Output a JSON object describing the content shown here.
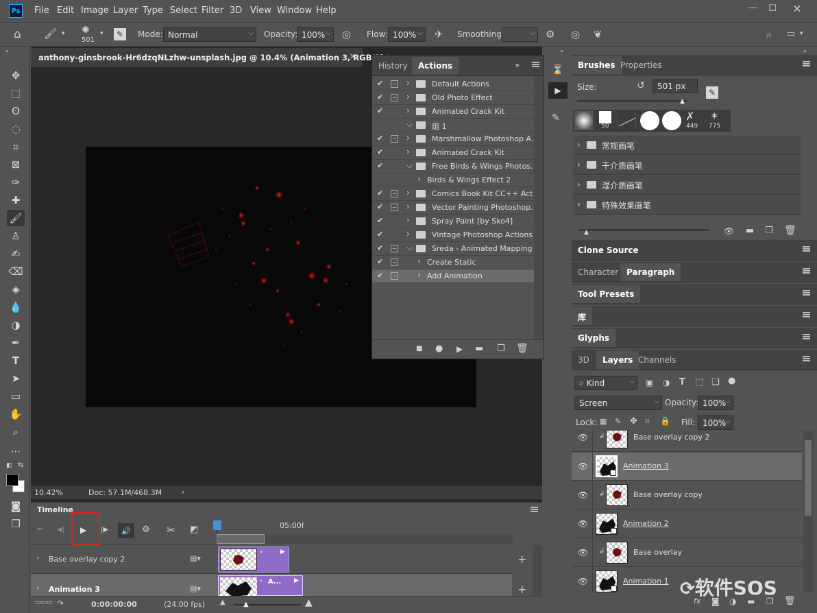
{
  "menu": {
    "logo": "Ps",
    "items": [
      "File",
      "Edit",
      "Image",
      "Layer",
      "Type",
      "Select",
      "Filter",
      "3D",
      "View",
      "Window",
      "Help"
    ]
  },
  "options": {
    "brush_size": "501",
    "mode_label": "Mode:",
    "mode_value": "Normal",
    "opacity_label": "Opacity:",
    "opacity_value": "100%",
    "flow_label": "Flow:",
    "flow_value": "100%",
    "smoothing_label": "Smoothing:",
    "smoothing_value": ""
  },
  "document": {
    "tab_title": "anthony-ginsbrook-Hr6dzqNLzhw-unsplash.jpg @ 10.4% (Animation 3, RGB/8) *",
    "zoom": "10.42%",
    "doc_info": "Doc: 57.1M/468.3M"
  },
  "actions_panel": {
    "tabs": [
      "History",
      "Actions"
    ],
    "rows": [
      {
        "check": "✔",
        "dialog": true,
        "indent": 0,
        "expanded": false,
        "folder": true,
        "label": "Default Actions"
      },
      {
        "check": "✔",
        "dialog": true,
        "indent": 0,
        "expanded": false,
        "folder": true,
        "label": "Old Photo Effect"
      },
      {
        "check": "✔",
        "dialog": false,
        "indent": 0,
        "expanded": false,
        "folder": true,
        "label": "Animated Crack Kit"
      },
      {
        "check": "",
        "dialog": false,
        "indent": 0,
        "expanded": true,
        "folder": true,
        "label": "组 1"
      },
      {
        "check": "✔",
        "dialog": true,
        "indent": 0,
        "expanded": false,
        "folder": true,
        "label": "Marshmallow Photoshop A..."
      },
      {
        "check": "✔",
        "dialog": false,
        "indent": 0,
        "expanded": false,
        "folder": true,
        "label": "Animated Crack Kit"
      },
      {
        "check": "✔",
        "dialog": false,
        "indent": 0,
        "expanded": true,
        "folder": true,
        "label": "Free Birds & Wings Photos..."
      },
      {
        "check": "",
        "dialog": false,
        "indent": 1,
        "expanded": false,
        "folder": false,
        "label": "Birds & Wings Effect 2"
      },
      {
        "check": "✔",
        "dialog": true,
        "indent": 0,
        "expanded": false,
        "folder": true,
        "label": "Comics Book Kit CC++ Act..."
      },
      {
        "check": "✔",
        "dialog": true,
        "indent": 0,
        "expanded": false,
        "folder": true,
        "label": "Vector Painting Photoshop..."
      },
      {
        "check": "✔",
        "dialog": false,
        "indent": 0,
        "expanded": false,
        "folder": true,
        "label": "Spray Paint [by Sko4]"
      },
      {
        "check": "✔",
        "dialog": false,
        "indent": 0,
        "expanded": false,
        "folder": true,
        "label": "Vintage Photoshop Actions"
      },
      {
        "check": "✔",
        "dialog": true,
        "indent": 0,
        "expanded": true,
        "folder": true,
        "label": "Sreda - Animated Mapping"
      },
      {
        "check": "✔",
        "dialog": true,
        "indent": 1,
        "expanded": false,
        "folder": false,
        "label": "Create Static"
      },
      {
        "check": "✔",
        "dialog": true,
        "indent": 1,
        "expanded": false,
        "folder": false,
        "label": "Add Animation",
        "selected": true
      }
    ]
  },
  "brushes_panel": {
    "tabs": [
      "Brushes",
      "Properties"
    ],
    "size_label": "Size:",
    "size_value": "501 px",
    "presets": [
      "50",
      "",
      "",
      "",
      "",
      "449",
      "775"
    ],
    "groups": [
      "常规画笔",
      "干介质画笔",
      "湿介质画笔",
      "特殊效果画笔"
    ]
  },
  "collapsed_panels": {
    "clone_source": "Clone Source",
    "character": "Character",
    "paragraph": "Paragraph",
    "tool_presets": "Tool Presets",
    "library": "库",
    "glyphs": "Glyphs"
  },
  "layers_panel": {
    "tabs": [
      "3D",
      "Layers",
      "Channels"
    ],
    "kind": "Kind",
    "blend_mode": "Screen",
    "opacity_label": "Opacity:",
    "opacity_value": "100%",
    "lock_label": "Lock:",
    "fill_label": "Fill:",
    "fill_value": "100%",
    "layers": [
      {
        "name": "Base overlay copy 2",
        "clipped": true,
        "selected": false,
        "type": "overlay"
      },
      {
        "name": "Animation 3",
        "clipped": false,
        "selected": true,
        "type": "smart"
      },
      {
        "name": "Base overlay copy",
        "clipped": true,
        "selected": false,
        "type": "overlay"
      },
      {
        "name": "Animation 2",
        "clipped": false,
        "selected": false,
        "type": "smart"
      },
      {
        "name": "Base overlay",
        "clipped": true,
        "selected": false,
        "type": "overlay"
      },
      {
        "name": "Animation 1",
        "clipped": false,
        "selected": false,
        "type": "smart"
      }
    ]
  },
  "timeline": {
    "title": "Timeline",
    "ruler_mark": "05:00f",
    "current_time": "0:00:00:00",
    "fps": "(24.00 fps)",
    "tracks": [
      {
        "name": "Base overlay copy 2",
        "clip_label": ""
      },
      {
        "name": "Animation 3",
        "clip_label": "A..."
      }
    ]
  },
  "watermark": "软件SOS",
  "colors": {
    "accent": "#4a90d9",
    "clip": "#8d6bc6",
    "highlight": "#e02020"
  }
}
